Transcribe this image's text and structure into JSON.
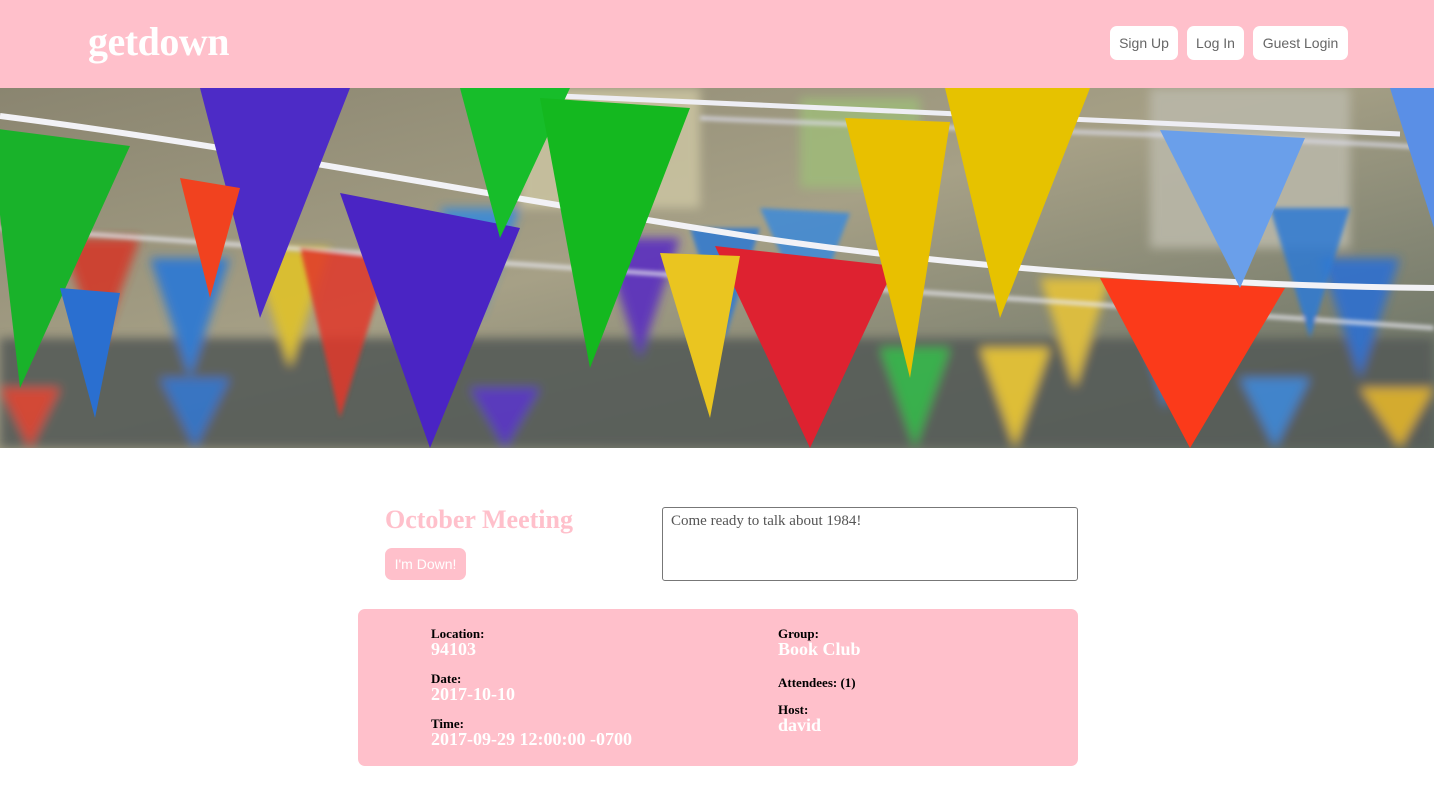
{
  "header": {
    "logo": "getdown",
    "nav": {
      "signup": "Sign Up",
      "login": "Log In",
      "guest_login": "Guest Login"
    },
    "background_color": "#ffc0cb"
  },
  "hero": {
    "image": "colorful-bunting-flags-photo"
  },
  "event": {
    "title": "October Meeting",
    "join_button": "I'm Down!",
    "description": "Come ready to talk about 1984!"
  },
  "details": {
    "location_label": "Location:",
    "location_value": "94103",
    "date_label": "Date:",
    "date_value": "2017-10-10",
    "time_label": "Time:",
    "time_value": "2017-09-29 12:00:00 -0700",
    "group_label": "Group:",
    "group_value": "Book Club",
    "attendees_label": "Attendees: (1)",
    "host_label": "Host:",
    "host_value": "david"
  },
  "colors": {
    "accent": "#ffc0cb",
    "accent_text": "#ffffff",
    "button_text": "#666666"
  }
}
